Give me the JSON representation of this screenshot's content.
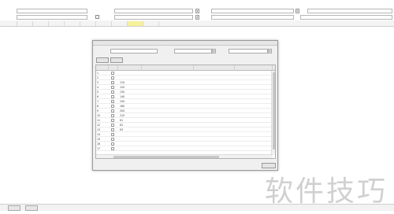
{
  "form": {
    "row1": {
      "label1": "",
      "value1": "",
      "label2": "",
      "value2": "",
      "label3": "",
      "value3": "",
      "label4": ""
    },
    "row2": {
      "label1": "",
      "value1": "",
      "label2": "",
      "value2": "",
      "label3": "",
      "value3": ""
    }
  },
  "tabs": [
    {
      "label": ""
    },
    {
      "label": ""
    },
    {
      "label": ""
    },
    {
      "label": ""
    },
    {
      "label": ""
    },
    {
      "label": ""
    },
    {
      "label": ""
    },
    {
      "label": ""
    },
    {
      "label": ""
    },
    {
      "label": ""
    }
  ],
  "dialog": {
    "title": "",
    "filter_label1": "",
    "filter_label2": "",
    "filter_label3": "",
    "search_button": "",
    "btn_select": "",
    "btn_close": "",
    "ok_button": "",
    "columns": [
      "",
      "",
      "",
      "",
      ""
    ],
    "rows": [
      {
        "no": "1",
        "code": ""
      },
      {
        "no": "2",
        "code": ""
      },
      {
        "no": "3",
        "code": "110"
      },
      {
        "no": "4",
        "code": "120"
      },
      {
        "no": "5",
        "code": "130"
      },
      {
        "no": "6",
        "code": "140"
      },
      {
        "no": "7",
        "code": "150"
      },
      {
        "no": "8",
        "code": "160"
      },
      {
        "no": "9",
        "code": "200"
      },
      {
        "no": "10",
        "code": "210"
      },
      {
        "no": "11",
        "code": "K1"
      },
      {
        "no": "12",
        "code": "K2"
      },
      {
        "no": "13",
        "code": "K3"
      },
      {
        "no": "14",
        "code": ""
      },
      {
        "no": "15",
        "code": ""
      },
      {
        "no": "16",
        "code": ""
      },
      {
        "no": "17",
        "code": ""
      }
    ]
  },
  "bottom": {
    "btn1": "",
    "btn2": ""
  },
  "watermark": "软件技巧"
}
